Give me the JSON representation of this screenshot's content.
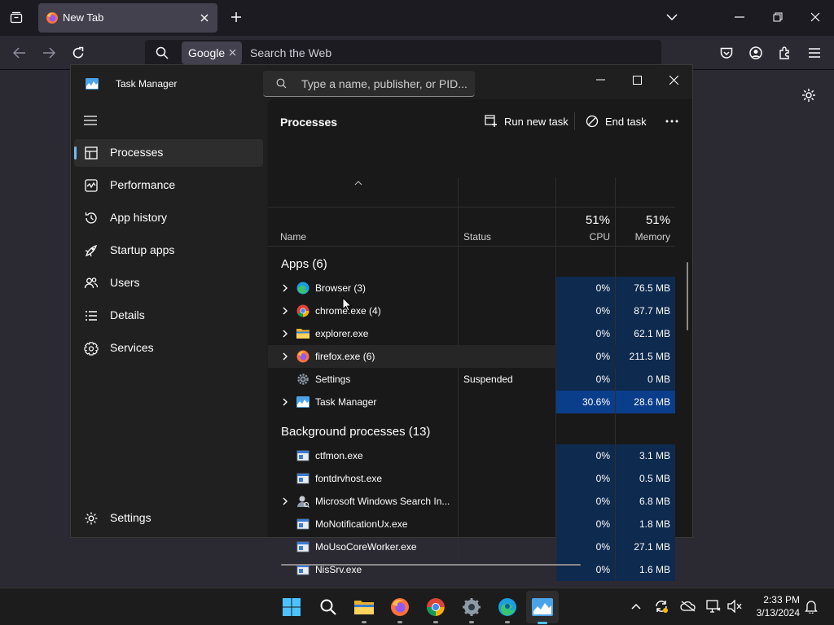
{
  "browser": {
    "tab_title": "New Tab",
    "search_engine": "Google",
    "url_placeholder": "Search the Web"
  },
  "task_manager": {
    "title": "Task Manager",
    "search_placeholder": "Type a name, publisher, or PID...",
    "nav": [
      {
        "label": "Processes",
        "icon": "processes-icon",
        "active": true
      },
      {
        "label": "Performance",
        "icon": "performance-icon"
      },
      {
        "label": "App history",
        "icon": "app-history-icon"
      },
      {
        "label": "Startup apps",
        "icon": "startup-apps-icon"
      },
      {
        "label": "Users",
        "icon": "users-icon"
      },
      {
        "label": "Details",
        "icon": "details-icon"
      },
      {
        "label": "Services",
        "icon": "services-icon"
      }
    ],
    "settings_label": "Settings",
    "header": {
      "title": "Processes",
      "run_new_task": "Run new task",
      "end_task": "End task"
    },
    "columns": {
      "name": "Name",
      "status": "Status",
      "cpu_label": "CPU",
      "cpu_total": "51%",
      "memory_label": "Memory",
      "memory_total": "51%"
    },
    "groups": {
      "apps": "Apps (6)",
      "background": "Background processes (13)"
    },
    "apps": [
      {
        "name": "Browser (3)",
        "icon": "edge-icon",
        "expandable": true,
        "status": "",
        "cpu": "0%",
        "memory": "76.5 MB"
      },
      {
        "name": "chrome.exe (4)",
        "icon": "chrome-icon",
        "expandable": true,
        "status": "",
        "cpu": "0%",
        "memory": "87.7 MB"
      },
      {
        "name": "explorer.exe",
        "icon": "folder-icon",
        "expandable": true,
        "status": "",
        "cpu": "0%",
        "memory": "62.1 MB"
      },
      {
        "name": "firefox.exe (6)",
        "icon": "firefox-icon",
        "expandable": true,
        "status": "",
        "cpu": "0%",
        "memory": "211.5 MB"
      },
      {
        "name": "Settings",
        "icon": "gear-icon",
        "expandable": false,
        "status": "Suspended",
        "cpu": "0%",
        "memory": "0 MB"
      },
      {
        "name": "Task Manager",
        "icon": "task-manager-icon",
        "expandable": true,
        "status": "",
        "cpu": "30.6%",
        "memory": "28.6 MB"
      }
    ],
    "background": [
      {
        "name": "ctfmon.exe",
        "icon": "process-icon",
        "expandable": false,
        "status": "",
        "cpu": "0%",
        "memory": "3.1 MB"
      },
      {
        "name": "fontdrvhost.exe",
        "icon": "process-icon",
        "expandable": false,
        "status": "",
        "cpu": "0%",
        "memory": "0.5 MB"
      },
      {
        "name": "Microsoft Windows Search In...",
        "icon": "search-indexer-icon",
        "expandable": true,
        "status": "",
        "cpu": "0%",
        "memory": "6.8 MB"
      },
      {
        "name": "MoNotificationUx.exe",
        "icon": "process-icon",
        "expandable": false,
        "status": "",
        "cpu": "0%",
        "memory": "1.8 MB"
      },
      {
        "name": "MoUsoCoreWorker.exe",
        "icon": "process-icon",
        "expandable": false,
        "status": "",
        "cpu": "0%",
        "memory": "27.1 MB"
      },
      {
        "name": "NisSrv.exe",
        "icon": "process-icon",
        "expandable": false,
        "status": "",
        "cpu": "0%",
        "memory": "1.6 MB"
      }
    ]
  },
  "taskbar": {
    "time": "2:33 PM",
    "date": "3/13/2024"
  },
  "colors": {
    "accent": "#76b9ed",
    "heat_low": "#0e2a4f",
    "heat_high": "#0b3e8a"
  }
}
